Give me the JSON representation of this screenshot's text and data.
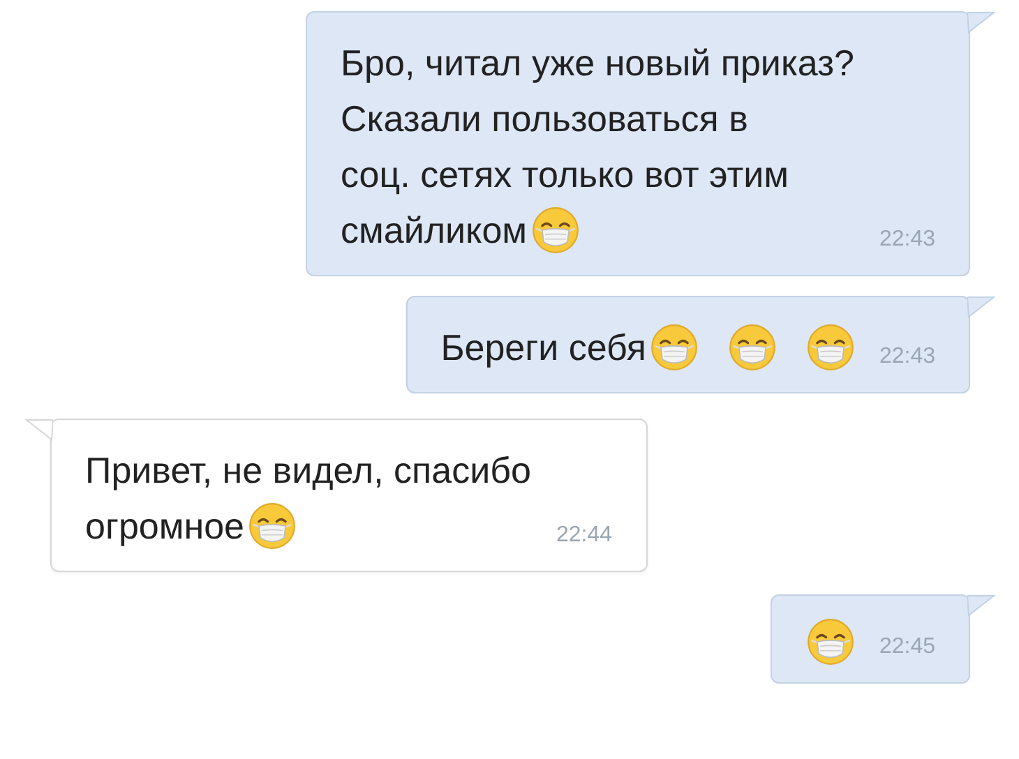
{
  "messages": [
    {
      "kind": "outgoing",
      "lines": [
        "Бро, читал уже новый приказ?",
        "Сказали пользоваться в",
        "соц. сетях только вот этим",
        "смайликом"
      ],
      "emojis": [
        {
          "kind": "mask"
        }
      ],
      "time": "22:43"
    },
    {
      "kind": "outgoing",
      "lines": [
        "Береги себя"
      ],
      "emojis": [
        {
          "kind": "mask"
        },
        {
          "kind": "mask"
        },
        {
          "kind": "mask"
        }
      ],
      "time": "22:43"
    },
    {
      "kind": "incoming",
      "lines": [
        "Привет, не видел, спасибо",
        "огромное"
      ],
      "emojis": [
        {
          "kind": "mask"
        }
      ],
      "time": "22:44"
    },
    {
      "kind": "outgoing",
      "emojis": [
        {
          "kind": "mask"
        }
      ],
      "time": "22:45"
    }
  ]
}
